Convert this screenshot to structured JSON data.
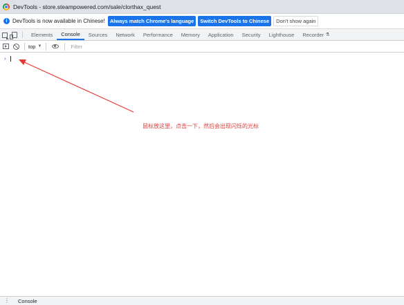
{
  "window": {
    "title": "DevTools - store.steampowered.com/sale/clorthax_quest"
  },
  "infobar": {
    "icon": "info-icon",
    "message": "DevTools is now available in Chinese!",
    "match_button": "Always match Chrome's language",
    "switch_button": "Switch DevTools to Chinese",
    "dismiss_button": "Don't show again"
  },
  "tabs": {
    "elements": "Elements",
    "console": "Console",
    "sources": "Sources",
    "network": "Network",
    "performance": "Performance",
    "memory": "Memory",
    "application": "Application",
    "security": "Security",
    "lighthouse": "Lighthouse",
    "recorder": "Recorder",
    "active": "Console"
  },
  "console_toolbar": {
    "context": "top",
    "filter_placeholder": "Filter"
  },
  "console": {
    "prompt": "›"
  },
  "annotation": {
    "text": "鼠标放这里，点击一下，然后会出现闪烁的光标",
    "color": "#e53935"
  },
  "drawer": {
    "tab": "Console"
  },
  "colors": {
    "accent": "#1a73e8",
    "annotation": "#e53935"
  }
}
